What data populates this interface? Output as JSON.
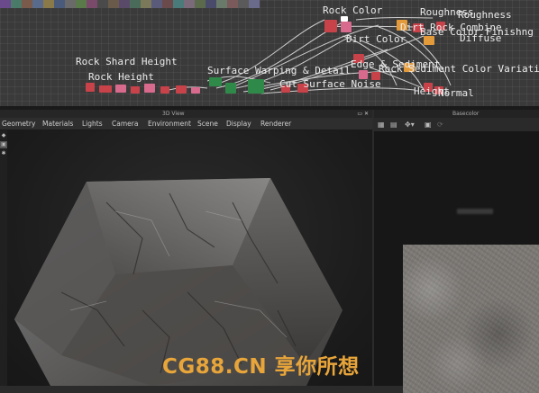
{
  "graph": {
    "frames": [
      {
        "id": "rock-shard-height",
        "text": "Rock Shard Height"
      },
      {
        "id": "rock-height",
        "text": "Rock Height"
      },
      {
        "id": "surface-warping",
        "text": "Surface Warping & Detail"
      },
      {
        "id": "cut-surface-noise",
        "text": "Cut Surface Noise"
      },
      {
        "id": "rock-color",
        "text": "Rock Color"
      },
      {
        "id": "dirt-color",
        "text": "Dirt Color"
      },
      {
        "id": "dirt-rock-combine",
        "text": "Dirt Rock Combine"
      },
      {
        "id": "roughness-a",
        "text": "Roughness"
      },
      {
        "id": "roughness-b",
        "text": "Roughness"
      },
      {
        "id": "base-color-finishing",
        "text": "Base Color Finishng"
      },
      {
        "id": "diffuse",
        "text": "Diffuse"
      },
      {
        "id": "edge-and-sediment",
        "text": "Edge & Sediment"
      },
      {
        "id": "rock-sediment",
        "text": "Rock Sediment Color Variati"
      },
      {
        "id": "height",
        "text": "Height"
      },
      {
        "id": "normal",
        "text": "Normal"
      }
    ]
  },
  "view3d": {
    "title": "3D View",
    "menu": [
      "Geometry",
      "Materials",
      "Lights",
      "Camera",
      "Environment",
      "Scene",
      "Display",
      "Renderer"
    ]
  },
  "panel2d": {
    "title": "Basecolor"
  },
  "watermark": {
    "text": "CG88.CN 享你所想",
    "color": "#e8a53a"
  },
  "colors": {
    "graph_bg": "#3a3a3a",
    "panel_bg": "#202020",
    "wire": "#e8e8e8",
    "node_red": "#c8424a",
    "node_pink": "#d86a8e",
    "node_orange": "#e39a3a",
    "node_green": "#2f8a4a"
  },
  "icons": [
    "grid-icon",
    "camera-icon",
    "transform-icon",
    "expand-icon",
    "close-icon",
    "refresh-icon"
  ]
}
